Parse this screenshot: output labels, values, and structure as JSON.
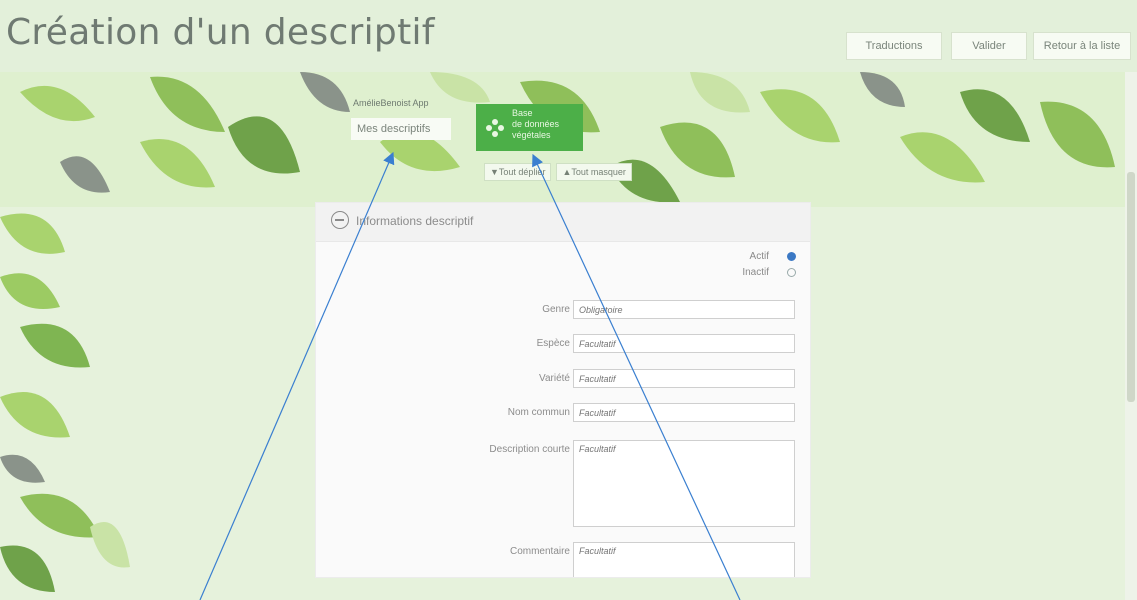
{
  "header": {
    "title": "Création d'un descriptif",
    "buttons": {
      "traductions": "Traductions",
      "valider": "Valider",
      "retour": "Retour à la liste"
    }
  },
  "banner": {
    "app_label": "AmélieBenoist App",
    "mes_descriptifs": "Mes descriptifs",
    "base_tile": {
      "line1": "Base",
      "line2": "de données",
      "line3": "végétales"
    },
    "tools": {
      "tout_deplier": "▼Tout déplier",
      "tout_masquer": "▲Tout masquer"
    }
  },
  "panel": {
    "title": "Informations descriptif",
    "status": {
      "actif": "Actif",
      "inactif": "Inactif",
      "selected": "Actif"
    },
    "fields": [
      {
        "label": "Genre",
        "placeholder": "Obligatoire"
      },
      {
        "label": "Espèce",
        "placeholder": "Facultatif"
      },
      {
        "label": "Variété",
        "placeholder": "Facultatif"
      },
      {
        "label": "Nom commun",
        "placeholder": "Facultatif"
      },
      {
        "label": "Description courte",
        "placeholder": "Facultatif"
      },
      {
        "label": "Commentaire",
        "placeholder": "Facultatif"
      }
    ]
  },
  "colors": {
    "tile_green": "#4caf48",
    "radio_selected": "#3b78c4",
    "arrow_blue": "#3a7fd0"
  }
}
